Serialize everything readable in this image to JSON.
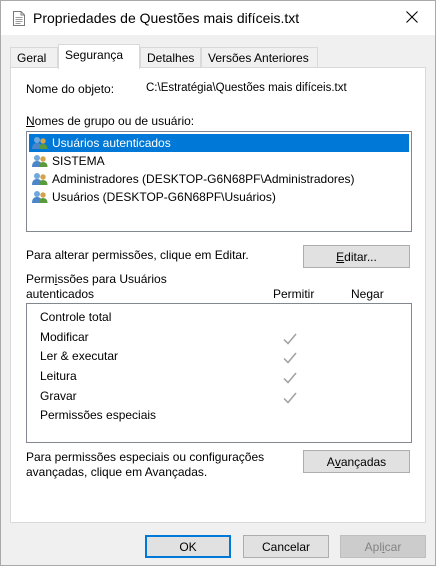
{
  "window": {
    "title": "Propriedades de Questões mais difíceis.txt"
  },
  "tabs": [
    {
      "label": "Geral",
      "active": false
    },
    {
      "label": "Segurança",
      "active": true
    },
    {
      "label": "Detalhes",
      "active": false
    },
    {
      "label": "Versões Anteriores",
      "active": false
    }
  ],
  "object": {
    "label": "Nome do objeto:",
    "value": "C:\\Estratégia\\Questões mais difíceis.txt"
  },
  "groups": {
    "label_prefix": "N",
    "label_rest": "omes de grupo ou de usuário:",
    "items": [
      {
        "label": "Usuários autenticados",
        "selected": true
      },
      {
        "label": "SISTEMA",
        "selected": false
      },
      {
        "label": "Administradores (DESKTOP-G6N68PF\\Administradores)",
        "selected": false
      },
      {
        "label": "Usuários (DESKTOP-G6N68PF\\Usuários)",
        "selected": false
      }
    ]
  },
  "edit": {
    "hint": "Para alterar permissões, clique em Editar.",
    "button_prefix": "E",
    "button_rest": "ditar..."
  },
  "permissions": {
    "title_part1": "Perm",
    "title_underline": "i",
    "title_part2": "ssões para Usuários",
    "title_line2": "autenticados",
    "col_allow": "Permitir",
    "col_deny": "Negar",
    "rows": [
      {
        "label": "Controle total",
        "allow": false,
        "deny": false
      },
      {
        "label": "Modificar",
        "allow": true,
        "deny": false
      },
      {
        "label": "Ler & executar",
        "allow": true,
        "deny": false
      },
      {
        "label": "Leitura",
        "allow": true,
        "deny": false
      },
      {
        "label": "Gravar",
        "allow": true,
        "deny": false
      },
      {
        "label": "Permissões especiais",
        "allow": false,
        "deny": false
      }
    ]
  },
  "advanced": {
    "hint_line1": "Para permissões especiais ou configurações",
    "hint_line2": "avançadas, clique em Avançadas.",
    "button_part1": "A",
    "button_underline": "v",
    "button_part2": "ançadas"
  },
  "footer": {
    "ok": "OK",
    "cancel": "Cancelar",
    "apply_part1": "Apl",
    "apply_underline": "i",
    "apply_part2": "car"
  },
  "colors": {
    "selection": "#0078d7",
    "check": "#a0a0a0"
  },
  "icons": {
    "title": "document-icon",
    "close": "close-icon",
    "users": "users-icon",
    "check": "check-icon"
  }
}
